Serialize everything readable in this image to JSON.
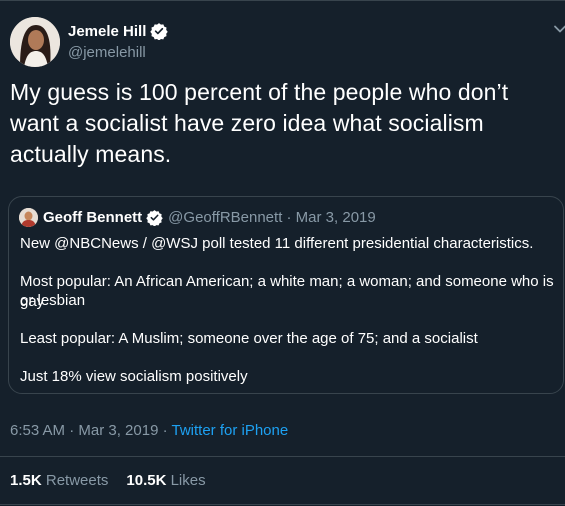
{
  "tweet": {
    "author_name": "Jemele Hill",
    "author_handle": "@jemelehill",
    "text": "My guess is 100 percent of the people who don’t want a socialist have zero idea what socialism actually means.",
    "timestamp": "6:53 AM · Mar 3, 2019 · ",
    "source": "Twitter for iPhone",
    "retweets_count": "1.5K",
    "retweets_label": "Retweets",
    "likes_count": "10.5K",
    "likes_label": "Likes"
  },
  "quoted_tweet": {
    "author_name": "Geoff Bennett",
    "author_handle_date": "@GeoffRBennett · Mar 3, 2019",
    "line1": "New @NBCNews / @WSJ poll tested 11 different presidential characteristics.",
    "line2a": "Most popular: An African American; a white man; a woman; and someone who is gay",
    "line2b": "or lesbian",
    "line3": "Least popular: A Muslim; someone over the age of 75; and a socialist",
    "line4": "Just 18% view socialism positively"
  },
  "icons": {
    "verified": "verified-badge-icon",
    "more": "chevron-down-icon"
  },
  "colors": {
    "background": "#15202b",
    "border": "#38444d",
    "secondary_text": "#8899a6",
    "link": "#1da1f2"
  }
}
